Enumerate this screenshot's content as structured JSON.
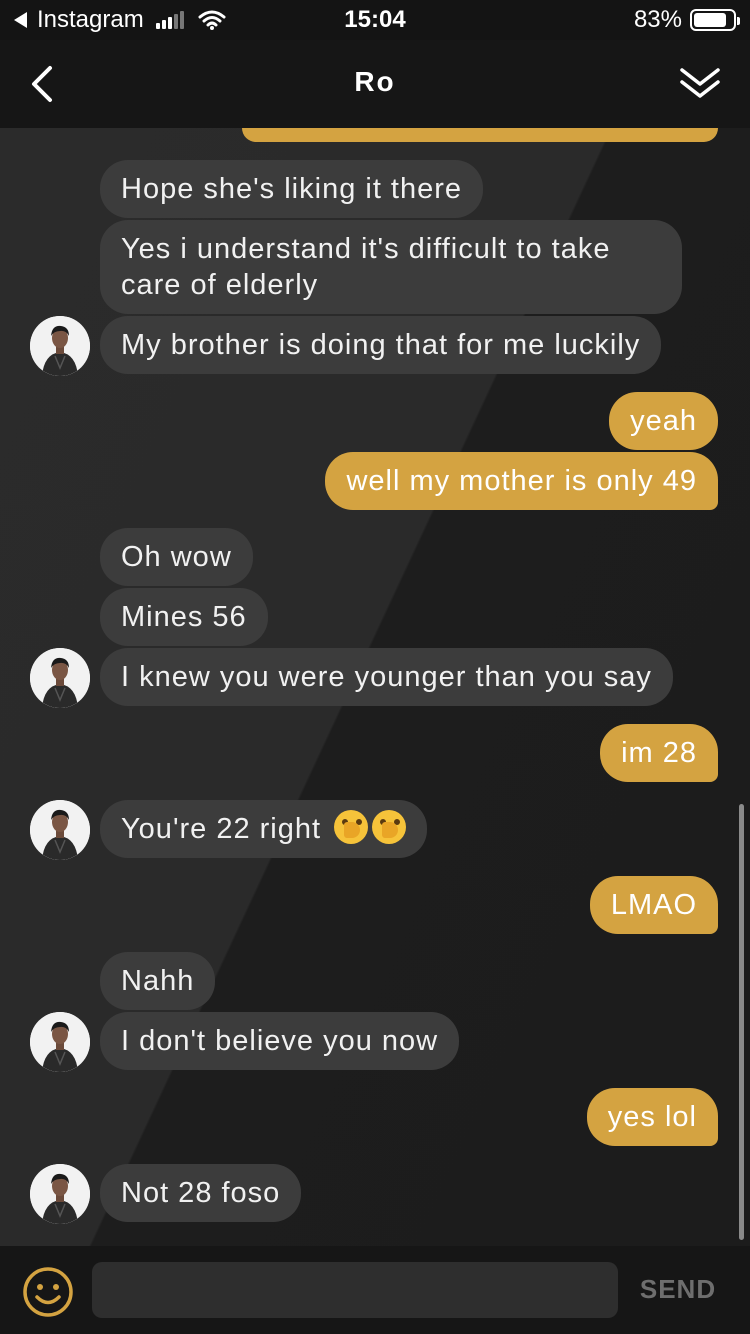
{
  "status_bar": {
    "back_app": "Instagram",
    "time": "15:04",
    "battery_text": "83%",
    "battery_level": 0.83
  },
  "header": {
    "title": "Ro",
    "back_icon": "chevron-left-icon",
    "collapse_icon": "double-chevron-down-icon"
  },
  "messages": [
    {
      "side": "received",
      "text": "Hope she's liking it there"
    },
    {
      "side": "received",
      "text": "Yes i understand it's difficult to take care of elderly"
    },
    {
      "side": "received",
      "text": "My brother is doing that for me luckily",
      "avatar": true
    },
    {
      "side": "sent",
      "text": "yeah"
    },
    {
      "side": "sent",
      "text": "well my mother is only 49"
    },
    {
      "side": "received",
      "text": "Oh wow"
    },
    {
      "side": "received",
      "text": "Mines 56"
    },
    {
      "side": "received",
      "text": "I knew you were younger than you say",
      "avatar": true
    },
    {
      "side": "sent",
      "text": "im 28"
    },
    {
      "side": "received",
      "text": "You're 22 right",
      "emoji": "face-with-hand-over-mouth",
      "emoji_count": 2,
      "avatar": true
    },
    {
      "side": "sent",
      "text": "LMAO"
    },
    {
      "side": "received",
      "text": "Nahh"
    },
    {
      "side": "received",
      "text": "I don't believe you now",
      "avatar": true
    },
    {
      "side": "sent",
      "text": "yes lol"
    },
    {
      "side": "received",
      "text": "Not 28 foso",
      "avatar": true
    }
  ],
  "composer": {
    "emoji_icon": "smiley-icon",
    "input_value": "",
    "send_label": "SEND"
  },
  "colors": {
    "sent_bubble": "#d4a341",
    "received_bubble": "#3c3c3c",
    "accent": "#d4a341"
  }
}
